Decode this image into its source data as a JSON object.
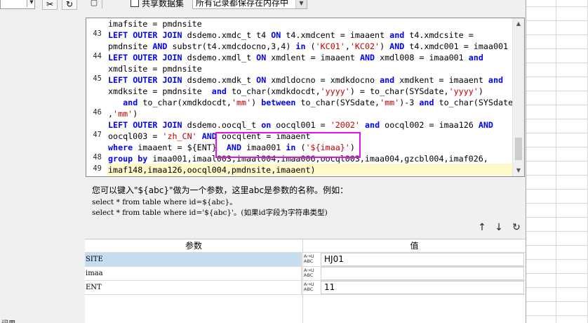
{
  "toolbar": {
    "share_label": "共享数据集",
    "mode_value": "所有记录都保存在内存中"
  },
  "editor": {
    "line_numbers": [
      "43",
      "44",
      "45",
      "46",
      "47",
      "48",
      "49"
    ],
    "lines": [
      "imafsite = pmdnsite",
      "LEFT OUTER JOIN dsdemo.xmdc_t t4 ON t4.xmdcent = imaaent and t4.xmdcsite =",
      "pmdnsite AND substr(t4.xmdcdocno,3,4) in ('KC01','KC02') AND t4.xmdc001 = imaa001",
      "LEFT OUTER JOIN dsdemo.xmdl_t ON xmdlent = imaaent AND xmdl008 = imaa001 and",
      "xmdlsite = pmdnsite",
      "LEFT OUTER JOIN dsdemo.xmdk_t ON xmdldocno = xmdkdocno and xmdkent = imaaent and",
      "xmdksite = pmdnsite  and to_char(xmdkdocdt,'yyyy') = to_char(SYSdate,'yyyy')",
      "   and to_char(xmdkdocdt,'mm') between to_char(SYSdate,'mm')-3 and to_char(SYSdate",
      ",'mm')",
      "LEFT OUTER JOIN dsdemo.oocql_t on oocql001 = '2002' and oocql002 = imaa126 AND",
      "oocql003 = 'zh_CN' AND oocqlent = imaaent",
      "where imaaent = ${ENT}  AND imaa001 in ('${imaa}')",
      "group by imaa001,imaal003,imaal004,imaa006,oocql003,imaa004,gzcbl004,imaf026,",
      "imaf148,imaa126,oocql004,pmdnsite,imaaent)"
    ]
  },
  "hint": {
    "main": "您可以键入\"${abc}\"做为一个参数，这里abc是参数的名称。例如：",
    "example1": "select * from table where id=${abc}。",
    "example2": "select * from table where id='${abc}'。(如果id字段为字符串类型)"
  },
  "params": {
    "header_name": "参数",
    "header_value": "值",
    "type_label": "A→U ABC",
    "rows": [
      {
        "name": "SITE",
        "value": "HJ01"
      },
      {
        "name": "imaa",
        "value": ""
      },
      {
        "name": "ENT",
        "value": "11"
      }
    ]
  },
  "left_panel": {
    "bottom_label": "间用"
  },
  "icons": [
    "toolbar-icon",
    "scissors-icon",
    "refresh-icon",
    "arrow-up-icon",
    "arrow-down-icon",
    "refresh-icon",
    "type-abc-icon"
  ]
}
